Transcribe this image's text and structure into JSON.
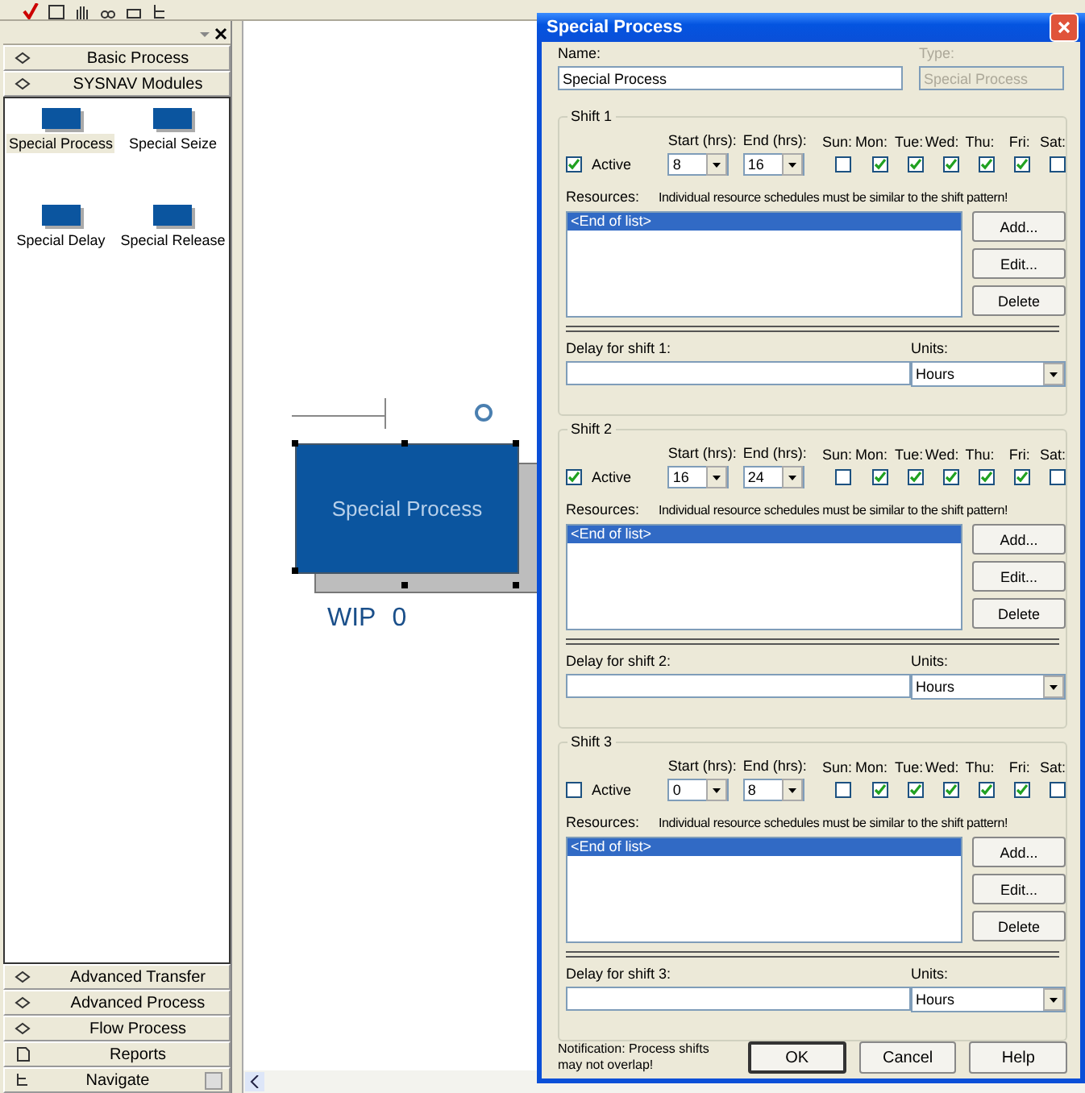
{
  "sidebar": {
    "sections_top": [
      {
        "label": "Basic Process"
      },
      {
        "label": "SYSNAV Modules"
      }
    ],
    "modules": [
      {
        "label": "Special Process",
        "selected": true
      },
      {
        "label": "Special Seize",
        "selected": false
      },
      {
        "label": "Special Delay",
        "selected": false
      },
      {
        "label": "Special Release",
        "selected": false
      }
    ],
    "sections_bottom": [
      {
        "label": "Advanced Transfer",
        "kind": "panel"
      },
      {
        "label": "Advanced Process",
        "kind": "panel"
      },
      {
        "label": "Flow Process",
        "kind": "panel"
      },
      {
        "label": "Reports",
        "kind": "reports"
      },
      {
        "label": "Navigate",
        "kind": "navigate"
      }
    ]
  },
  "canvas": {
    "module_label": "Special Process",
    "wip_label": "WIP",
    "wip_value": "0"
  },
  "dialog": {
    "title": "Special Process",
    "name_label": "Name:",
    "name_value": "Special Process",
    "type_label": "Type:",
    "type_value": "Special Process",
    "type_disabled": true,
    "shifts": [
      {
        "title": "Shift 1",
        "active_label": "Active",
        "active": true,
        "start_label": "Start (hrs):",
        "start": "8",
        "end_label": "End (hrs):",
        "end": "16",
        "days": [
          {
            "label": "Sun:",
            "checked": false
          },
          {
            "label": "Mon:",
            "checked": true
          },
          {
            "label": "Tue:",
            "checked": true
          },
          {
            "label": "Wed:",
            "checked": true
          },
          {
            "label": "Thu:",
            "checked": true
          },
          {
            "label": "Fri:",
            "checked": true
          },
          {
            "label": "Sat:",
            "checked": false
          }
        ],
        "resources_label": "Resources:",
        "resources_note": "Individual resource schedules must be similar to the shift pattern!",
        "list_items": [
          {
            "label": "<End of list>",
            "selected": true
          }
        ],
        "buttons": [
          "Add...",
          "Edit...",
          "Delete"
        ],
        "delay_label": "Delay for shift 1:",
        "units_label": "Units:",
        "units": "Hours"
      },
      {
        "title": "Shift 2",
        "active_label": "Active",
        "active": true,
        "start_label": "Start (hrs):",
        "start": "16",
        "end_label": "End (hrs):",
        "end": "24",
        "days": [
          {
            "label": "Sun:",
            "checked": false
          },
          {
            "label": "Mon:",
            "checked": true
          },
          {
            "label": "Tue:",
            "checked": true
          },
          {
            "label": "Wed:",
            "checked": true
          },
          {
            "label": "Thu:",
            "checked": true
          },
          {
            "label": "Fri:",
            "checked": true
          },
          {
            "label": "Sat:",
            "checked": false
          }
        ],
        "resources_label": "Resources:",
        "resources_note": "Individual resource schedules must be similar to the shift pattern!",
        "list_items": [
          {
            "label": "<End of list>",
            "selected": true
          }
        ],
        "buttons": [
          "Add...",
          "Edit...",
          "Delete"
        ],
        "delay_label": "Delay for shift 2:",
        "units_label": "Units:",
        "units": "Hours"
      },
      {
        "title": "Shift 3",
        "active_label": "Active",
        "active": false,
        "start_label": "Start (hrs):",
        "start": "0",
        "end_label": "End (hrs):",
        "end": "8",
        "days": [
          {
            "label": "Sun:",
            "checked": false
          },
          {
            "label": "Mon:",
            "checked": true
          },
          {
            "label": "Tue:",
            "checked": true
          },
          {
            "label": "Wed:",
            "checked": true
          },
          {
            "label": "Thu:",
            "checked": true
          },
          {
            "label": "Fri:",
            "checked": true
          },
          {
            "label": "Sat:",
            "checked": false
          }
        ],
        "resources_label": "Resources:",
        "resources_note": "Individual resource schedules must be similar to the shift pattern!",
        "list_items": [
          {
            "label": "<End of list>",
            "selected": true
          }
        ],
        "buttons": [
          "Add...",
          "Edit...",
          "Delete"
        ],
        "delay_label": "Delay for shift 3:",
        "units_label": "Units:",
        "units": "Hours"
      }
    ],
    "notification": "Notification: Process shifts may not overlap!",
    "footer_buttons": [
      "OK",
      "Cancel",
      "Help"
    ]
  }
}
